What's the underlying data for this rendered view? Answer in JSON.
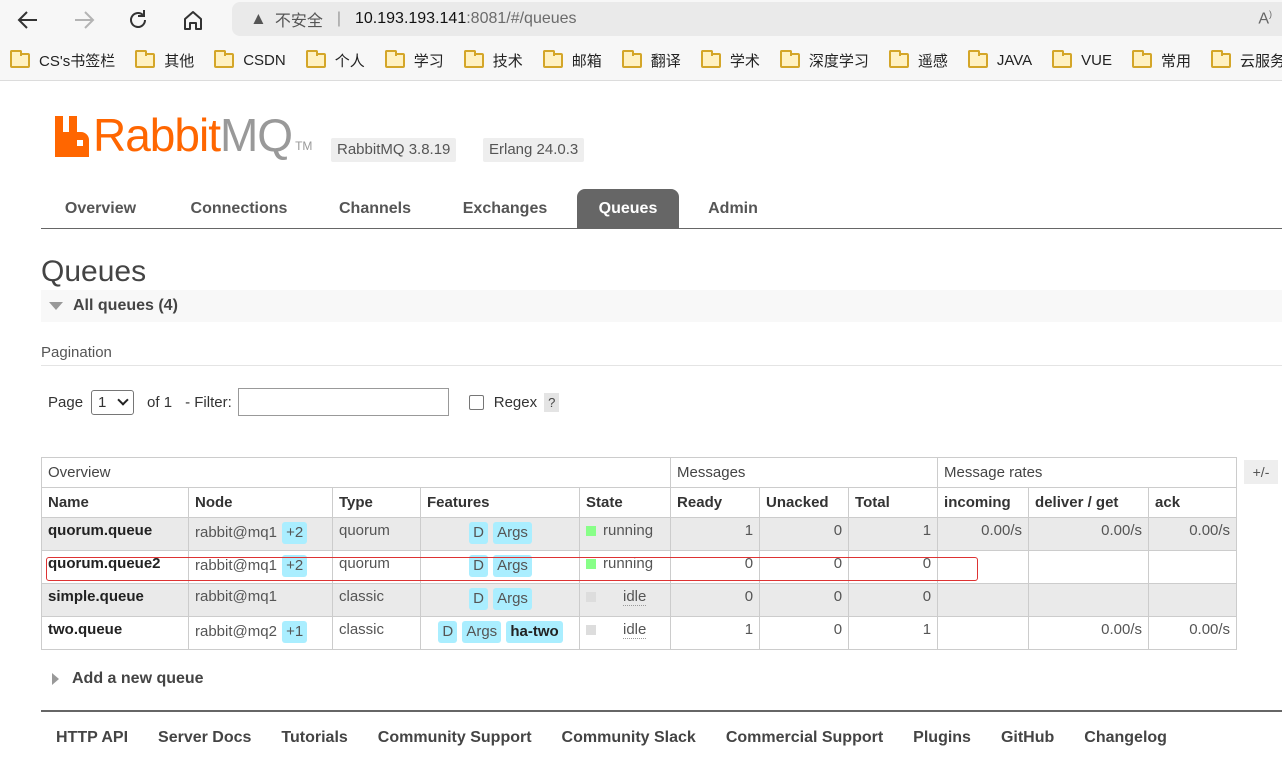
{
  "browser": {
    "security_label": "不安全",
    "url_host": "10.193.193.141",
    "url_path": ":8081/#/queues",
    "bookmarks": [
      "CS's书签栏",
      "其他",
      "CSDN",
      "个人",
      "学习",
      "技术",
      "邮箱",
      "翻译",
      "学术",
      "深度学习",
      "遥感",
      "JAVA",
      "VUE",
      "常用",
      "云服务"
    ]
  },
  "header": {
    "logo_rabbit": "Rabbit",
    "logo_mq": "MQ",
    "logo_tm": "TM",
    "rabbitmq_version": "RabbitMQ 3.8.19",
    "erlang_version": "Erlang 24.0.3"
  },
  "nav": {
    "tabs": [
      "Overview",
      "Connections",
      "Channels",
      "Exchanges",
      "Queues",
      "Admin"
    ],
    "active": "Queues"
  },
  "page": {
    "title": "Queues",
    "section": "All queues (4)",
    "pagination_label": "Pagination",
    "page_label": "Page",
    "page_value": "1",
    "of_label": "of 1",
    "filter_label": "- Filter:",
    "filter_value": "",
    "regex_label": "Regex",
    "help_label": "?"
  },
  "table": {
    "groups": [
      "Overview",
      "Messages",
      "Message rates"
    ],
    "columns": [
      "Name",
      "Node",
      "Type",
      "Features",
      "State",
      "Ready",
      "Unacked",
      "Total",
      "incoming",
      "deliver / get",
      "ack"
    ],
    "toggle_label": "+/-",
    "rows": [
      {
        "name": "quorum.queue",
        "node": "rabbit@mq1",
        "node_badge": "+2",
        "type": "quorum",
        "features": [
          "D",
          "Args"
        ],
        "state": "running",
        "ready": "1",
        "unacked": "0",
        "total": "1",
        "incoming": "0.00/s",
        "deliver_get": "0.00/s",
        "ack": "0.00/s"
      },
      {
        "name": "quorum.queue2",
        "node": "rabbit@mq1",
        "node_badge": "+2",
        "type": "quorum",
        "features": [
          "D",
          "Args"
        ],
        "state": "running",
        "ready": "0",
        "unacked": "0",
        "total": "0",
        "incoming": "",
        "deliver_get": "",
        "ack": ""
      },
      {
        "name": "simple.queue",
        "node": "rabbit@mq1",
        "node_badge": "",
        "type": "classic",
        "features": [
          "D",
          "Args"
        ],
        "state": "idle",
        "ready": "0",
        "unacked": "0",
        "total": "0",
        "incoming": "",
        "deliver_get": "",
        "ack": ""
      },
      {
        "name": "two.queue",
        "node": "rabbit@mq2",
        "node_badge": "+1",
        "type": "classic",
        "features": [
          "D",
          "Args",
          "ha-two"
        ],
        "state": "idle",
        "ready": "1",
        "unacked": "0",
        "total": "1",
        "incoming": "",
        "deliver_get": "0.00/s",
        "ack": "0.00/s"
      }
    ]
  },
  "add_queue_label": "Add a new queue",
  "footer": [
    "HTTP API",
    "Server Docs",
    "Tutorials",
    "Community Support",
    "Community Slack",
    "Commercial Support",
    "Plugins",
    "GitHub",
    "Changelog"
  ],
  "colors": {
    "brand_orange": "#ff6600",
    "tab_active_bg": "#666666",
    "tag_bg": "#aaeeff",
    "running": "#88ff88",
    "idle": "#dddddd",
    "highlight_annotation": "#dd3333"
  }
}
